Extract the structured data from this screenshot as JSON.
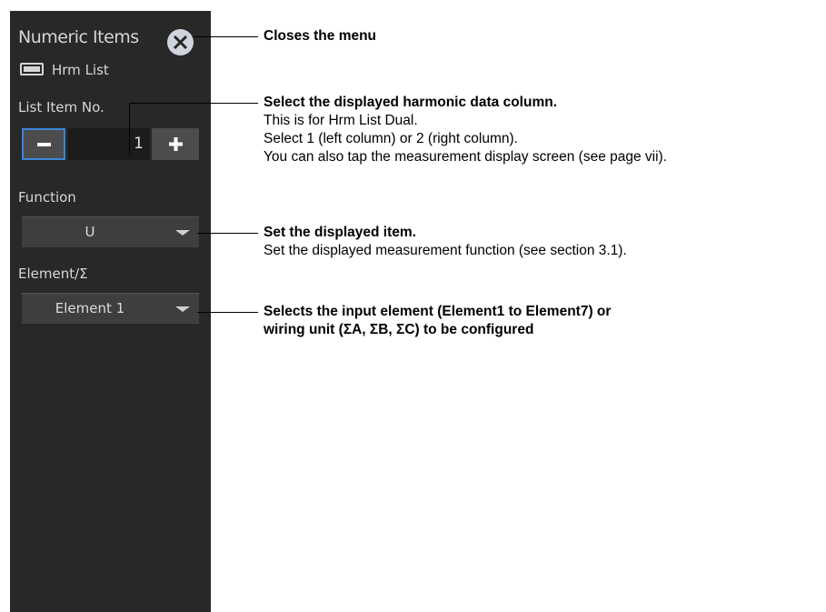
{
  "menu": {
    "title": "Numeric Items",
    "close_icon": "close-icon",
    "mode_icon": "hrm-list-icon",
    "mode_label": "Hrm List",
    "list_item_label": "List Item No.",
    "list_item_value": "1",
    "function_label": "Function",
    "function_value": "U",
    "element_label": "Element/Σ",
    "element_value": "Element 1"
  },
  "annotations": {
    "close": {
      "title": "Closes the menu"
    },
    "list_item": {
      "title": "Select the displayed harmonic data column.",
      "lines": [
        "This is for Hrm List Dual.",
        "Select 1 (left column) or 2 (right column).",
        "You can also tap the measurement display screen (see page vii)."
      ]
    },
    "function": {
      "title": "Set the displayed item.",
      "lines": [
        "Set the displayed measurement function (see section 3.1)."
      ]
    },
    "element": {
      "title_lines": [
        "Selects the input element (Element1 to Element7) or",
        "wiring unit (ΣA, ΣB, ΣC) to be configured"
      ]
    }
  },
  "colors": {
    "panel_bg": "#282828",
    "accent_border": "#3b86d8",
    "button_bg": "#4c4c4c"
  }
}
